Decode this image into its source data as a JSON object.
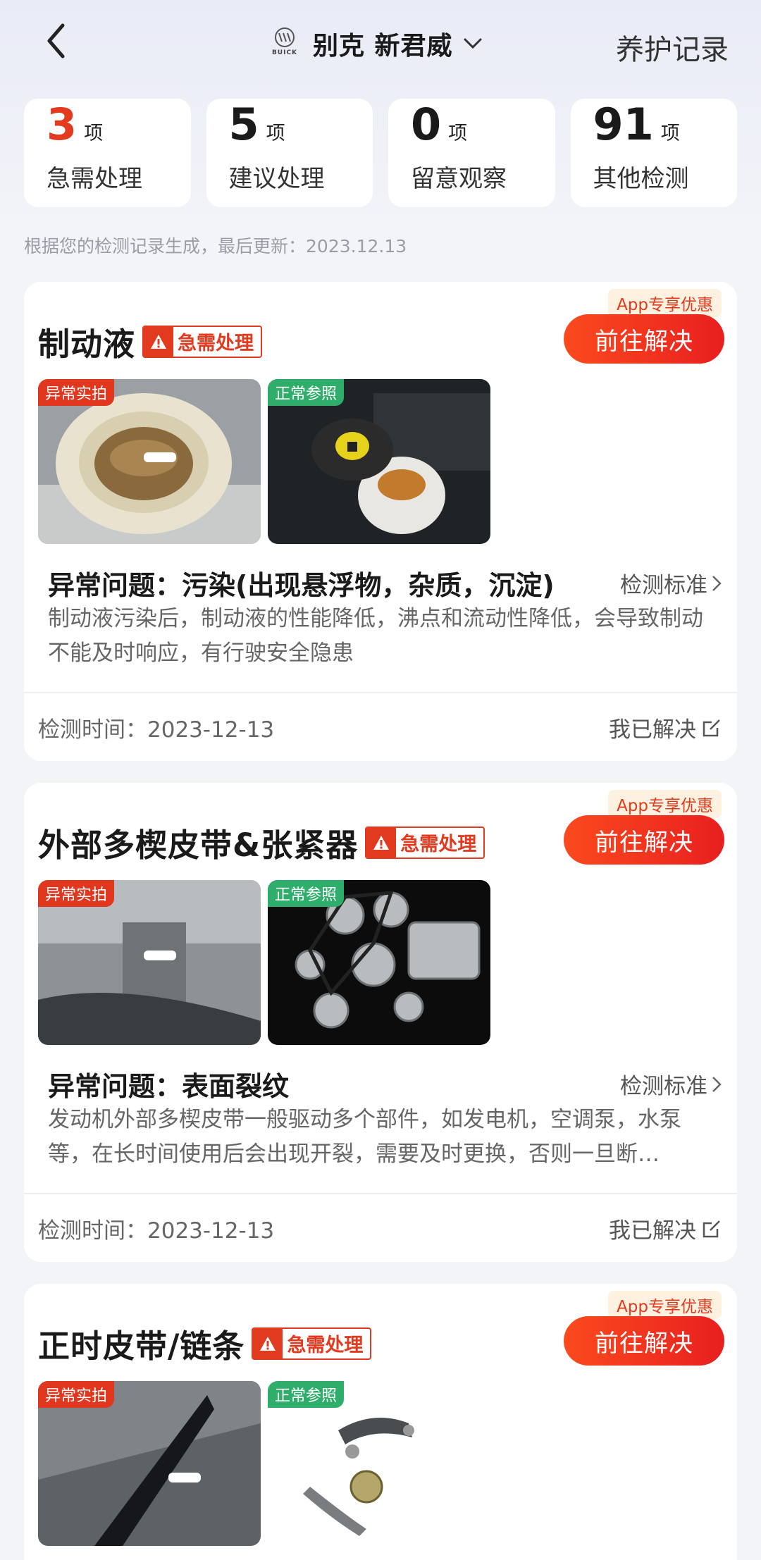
{
  "header": {
    "brand_word": "BUICK",
    "car_name": "别克 新君威",
    "records_label": "养护记录"
  },
  "stats": [
    {
      "num": "3",
      "unit": "项",
      "label": "急需处理",
      "color": "#e23a1f"
    },
    {
      "num": "5",
      "unit": "项",
      "label": "建议处理",
      "color": "#1a1a1a"
    },
    {
      "num": "0",
      "unit": "项",
      "label": "留意观察",
      "color": "#1a1a1a"
    },
    {
      "num": "91",
      "unit": "项",
      "label": "其他检测",
      "color": "#1a1a1a"
    }
  ],
  "note": "根据您的检测记录生成，最后更新：2023.12.13",
  "common": {
    "promo": "App专享优惠",
    "badge": "急需处理",
    "go_label": "前往解决",
    "abnormal_tag": "异常实拍",
    "normal_tag": "正常参照",
    "standard_label": "检测标准",
    "solved_label": "我已解决"
  },
  "cards": [
    {
      "title": "制动液",
      "issue": "异常问题：污染(出现悬浮物，杂质，沉淀)",
      "desc": "制动液污染后，制动液的性能降低，沸点和流动性降低，会导致制动不能及时响应，有行驶安全隐患",
      "time": "检测时间：2023-12-13"
    },
    {
      "title": "外部多楔皮带&张紧器",
      "issue": "异常问题：表面裂纹",
      "desc": "发动机外部多楔皮带一般驱动多个部件，如发电机，空调泵，水泵等，在长时间使用后会出现开裂，需要及时更换，否则一旦断…",
      "time": "检测时间：2023-12-13"
    },
    {
      "title": "正时皮带/链条",
      "issue": "",
      "desc": "",
      "time": ""
    }
  ],
  "colors": {
    "accent": "#e23a1f",
    "normal_tag": "#2fae6b",
    "button": "#fb4a1e"
  }
}
